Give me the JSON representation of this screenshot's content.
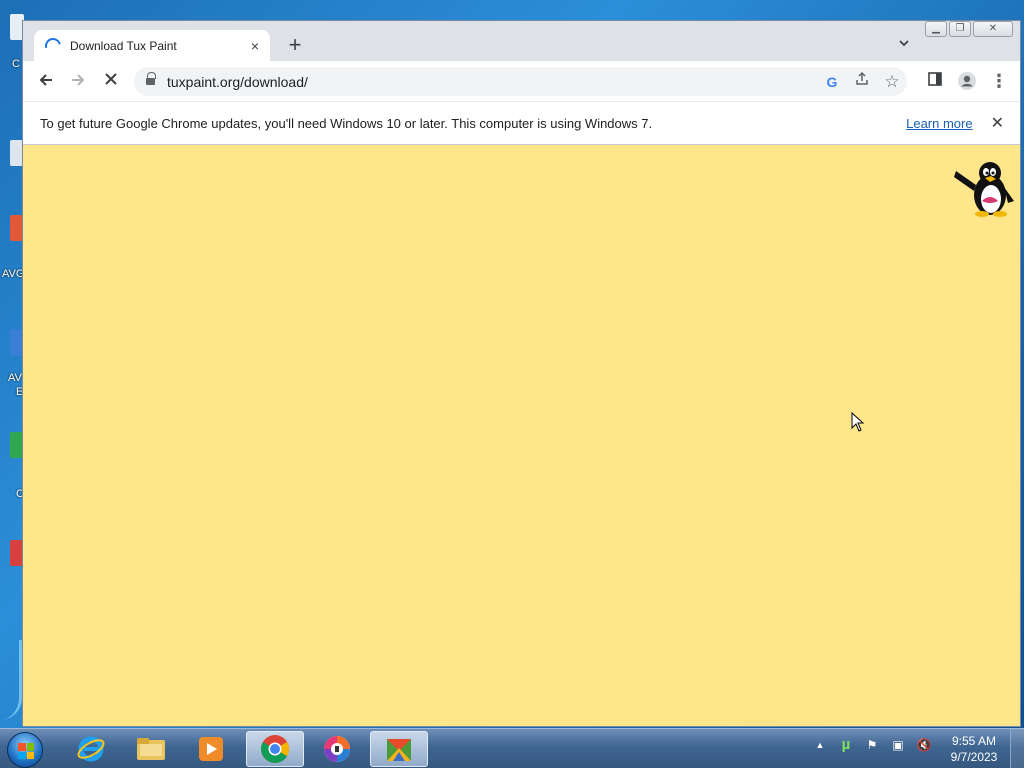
{
  "browser": {
    "tab": {
      "title": "Download Tux Paint",
      "close_icon": "×"
    },
    "new_tab_icon": "+",
    "tab_search_icon": "⌄",
    "window_controls": {
      "minimize": "▁",
      "restore": "❐",
      "close": "✕"
    },
    "toolbar": {
      "back_icon": "←",
      "forward_icon": "→",
      "stop_icon": "✕",
      "url": "tuxpaint.org/download/",
      "google_icon": "G",
      "share_icon": "⇪",
      "bookmark_icon": "☆",
      "sidepanel_icon": "◨",
      "profile_icon": "●",
      "menu_icon": "⋮"
    },
    "infobar": {
      "message": "To get future Google Chrome updates, you'll need Windows 10 or later. This computer is using Windows 7.",
      "link": "Learn more",
      "close_icon": "✕"
    },
    "page": {
      "background_color": "#ffe68a"
    }
  },
  "desktop": {
    "labels": [
      "C",
      "AVG",
      "AV",
      "E",
      "C"
    ]
  },
  "taskbar": {
    "apps": [
      {
        "name": "internet-explorer",
        "active": false
      },
      {
        "name": "file-explorer",
        "active": false
      },
      {
        "name": "media-player",
        "active": false
      },
      {
        "name": "google-chrome",
        "active": true
      },
      {
        "name": "avg-secure-browser",
        "active": false
      },
      {
        "name": "avg-antivirus",
        "active": false
      }
    ],
    "tray": {
      "show_hidden_icon": "▲",
      "utorrent_icon": "µ",
      "action_center_icon": "⚑",
      "network_icon": "▣",
      "volume_icon": "🔇"
    },
    "clock": {
      "time": "9:55 AM",
      "date": "9/7/2023"
    }
  }
}
